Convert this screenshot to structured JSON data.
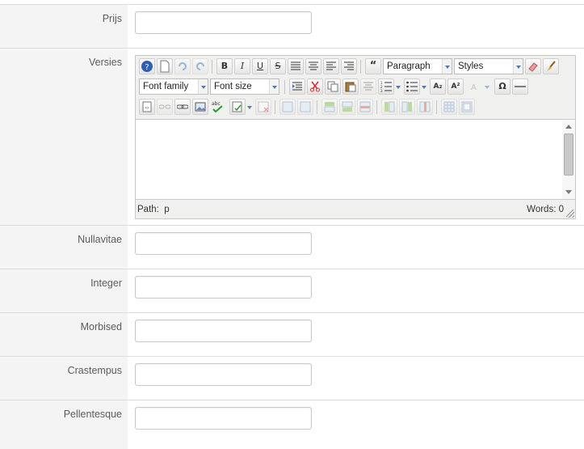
{
  "fields": {
    "prijs": {
      "label": "Prijs",
      "value": ""
    },
    "versies": {
      "label": "Versies"
    },
    "nullavitae": {
      "label": "Nullavitae",
      "value": ""
    },
    "integer": {
      "label": "Integer",
      "value": ""
    },
    "morbised": {
      "label": "Morbised",
      "value": ""
    },
    "crastempus": {
      "label": "Crastempus",
      "value": ""
    },
    "pellentesque": {
      "label": "Pellentesque",
      "value": ""
    }
  },
  "editor": {
    "format_select": "Paragraph",
    "styles_select": "Styles",
    "font_family_select": "Font family",
    "font_size_select": "Font size",
    "buttons": {
      "bold": "B",
      "italic": "I",
      "underline": "U",
      "strike": "S",
      "blockquote": "“",
      "subscript": "A₂",
      "superscript": "A²",
      "omega": "Ω",
      "spell": "abc"
    },
    "status_path_label": "Path:",
    "status_path_value": "p",
    "status_words_label": "Words:",
    "status_words_value": "0"
  },
  "colors": {
    "label_bg": "#f4f4f4",
    "border": "#dcdcdc",
    "accent": "#4a7bb7"
  }
}
